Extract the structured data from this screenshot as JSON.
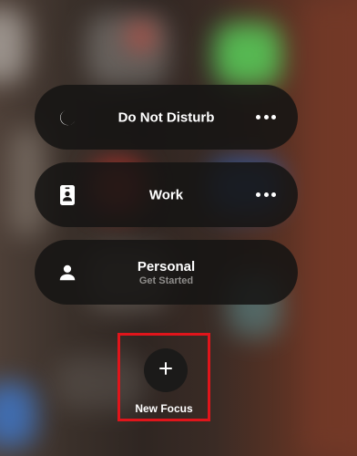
{
  "focus_modes": [
    {
      "label": "Do Not Disturb",
      "icon": "moon-icon",
      "has_more": true
    },
    {
      "label": "Work",
      "icon": "id-badge-icon",
      "has_more": true
    },
    {
      "label": "Personal",
      "subtitle": "Get Started",
      "icon": "person-icon",
      "has_more": false
    }
  ],
  "new_focus": {
    "label": "New Focus",
    "icon": "plus-icon"
  },
  "colors": {
    "pill_background": "#161413",
    "highlight_border": "#e0151b",
    "subtitle": "#8e8c8a"
  }
}
